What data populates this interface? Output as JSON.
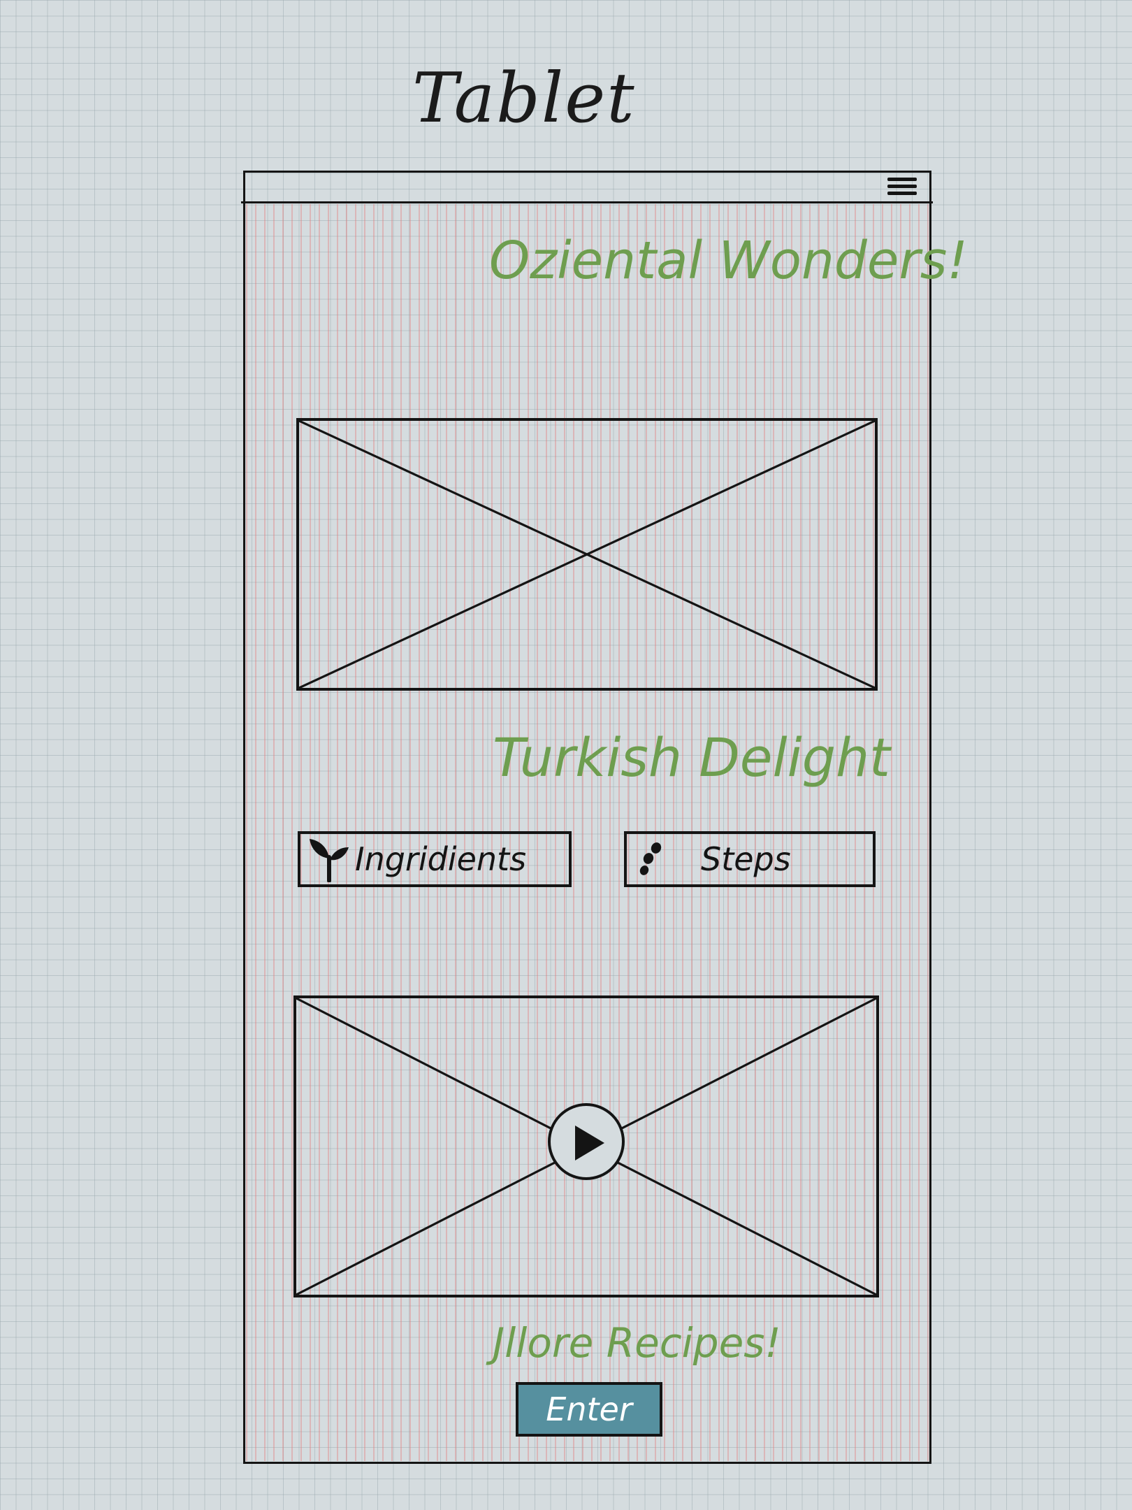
{
  "sketch": {
    "title": "Tablet"
  },
  "header": {
    "menu_icon": "hamburger-menu-icon"
  },
  "main": {
    "heading": "Oziental Wonders!",
    "image_placeholder_icon": "image-placeholder-icon",
    "recipe_title": "Turkish Delight",
    "tabs": [
      {
        "label": "Ingridients",
        "icon": "sprout-icon"
      },
      {
        "label": "Steps",
        "icon": "seeds-icon"
      }
    ],
    "video_icon": "play-icon"
  },
  "footer": {
    "more_text": "Jllore Recipes!",
    "enter_label": "Enter"
  },
  "colors": {
    "background": "#d5dcdf",
    "grid": "#96a5ac",
    "hatch": "#e47878",
    "accent_green": "#6e9e4f",
    "button_teal": "#56909f",
    "ink": "#141414"
  }
}
